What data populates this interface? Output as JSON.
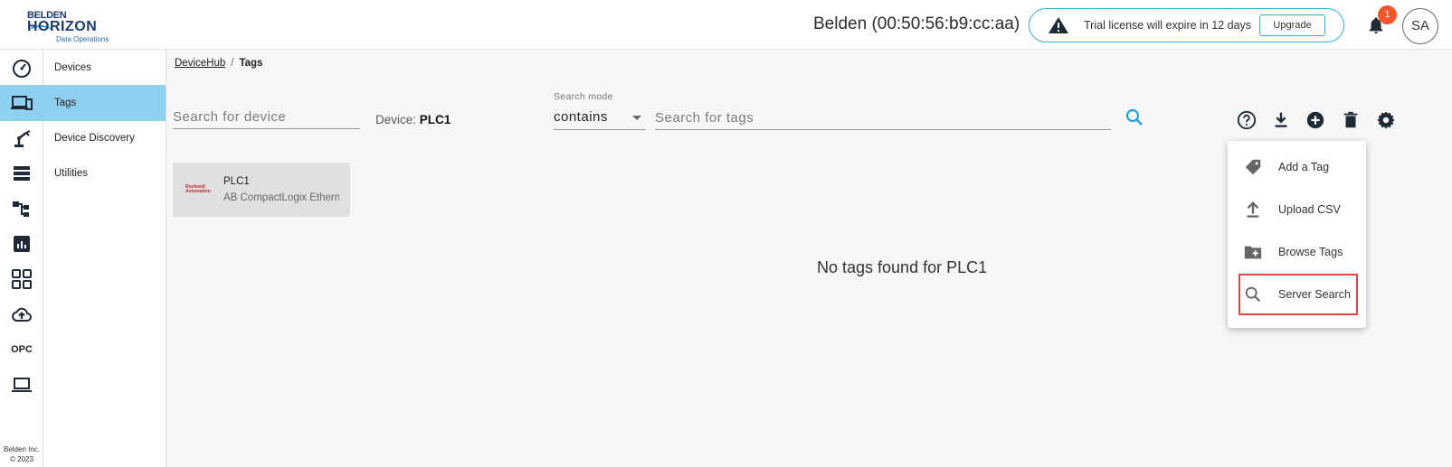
{
  "header": {
    "logo": {
      "brand_top": "BELDEN",
      "brand_main": "HORIZON",
      "brand_sub": "Data Operations"
    },
    "device_title": "Belden (00:50:56:b9:cc:aa)",
    "trial_message": "Trial license will expire in 12 days",
    "upgrade_label": "Upgrade",
    "notification_count": "1",
    "user_initials": "SA"
  },
  "rail": {
    "opc_label": "OPC",
    "footer_line1": "Belden Inc.",
    "footer_line2": "© 2023"
  },
  "subnav": {
    "items": [
      {
        "label": "Devices"
      },
      {
        "label": "Tags"
      },
      {
        "label": "Device Discovery"
      },
      {
        "label": "Utilities"
      }
    ]
  },
  "breadcrumb": {
    "root": "DeviceHub",
    "separator": "/",
    "current": "Tags"
  },
  "filters": {
    "device_search_placeholder": "Search for device",
    "device_label": "Device:",
    "device_value": "PLC1",
    "search_mode_label": "Search mode",
    "search_mode_value": "contains",
    "tag_search_placeholder": "Search for tags"
  },
  "device_card": {
    "logo_text_1": "Rockwell",
    "logo_text_2": "Automation",
    "name": "PLC1",
    "model": "AB CompactLogix Ethernet"
  },
  "empty_message": "No tags found for PLC1",
  "menu": {
    "items": [
      {
        "label": "Add a Tag",
        "icon": "tag-icon"
      },
      {
        "label": "Upload CSV",
        "icon": "upload-icon"
      },
      {
        "label": "Browse Tags",
        "icon": "folder-add-icon"
      },
      {
        "label": "Server Search",
        "icon": "search-icon"
      }
    ]
  },
  "colors": {
    "accent": "#8fd0f0",
    "link_blue": "#3aa9d6",
    "badge": "#f0562a",
    "highlight": "#e04848"
  }
}
